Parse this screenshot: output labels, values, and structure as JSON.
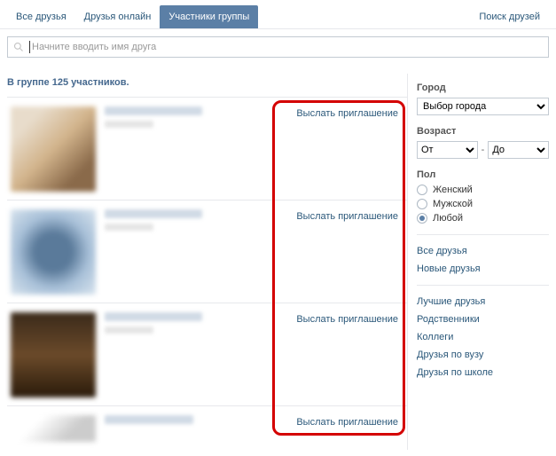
{
  "tabs": {
    "all_friends": "Все друзья",
    "friends_online": "Друзья онлайн",
    "group_members": "Участники группы",
    "search_friends": "Поиск друзей"
  },
  "search": {
    "placeholder": "Начните вводить имя друга"
  },
  "header": {
    "count_text": "В группе 125 участников."
  },
  "members": [
    {
      "invite": "Выслать приглашение"
    },
    {
      "invite": "Выслать приглашение"
    },
    {
      "invite": "Выслать приглашение"
    },
    {
      "invite": "Выслать приглашение"
    }
  ],
  "sidebar": {
    "city_label": "Город",
    "city_select": "Выбор города",
    "age_label": "Возраст",
    "age_from": "От",
    "age_to": "До",
    "gender_label": "Пол",
    "gender": {
      "female": "Женский",
      "male": "Мужской",
      "any": "Любой"
    },
    "filters1": {
      "all": "Все друзья",
      "new": "Новые друзья"
    },
    "filters2": {
      "best": "Лучшие друзья",
      "relatives": "Родственники",
      "colleagues": "Коллеги",
      "university": "Друзья по вузу",
      "school": "Друзья по школе"
    }
  }
}
